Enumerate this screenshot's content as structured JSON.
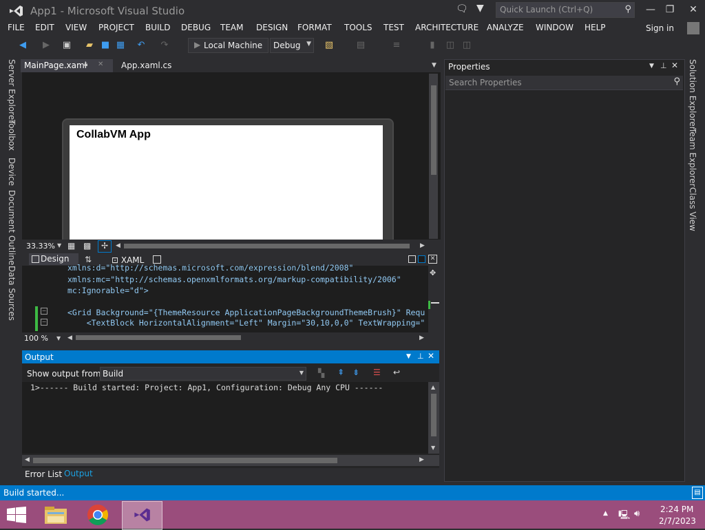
{
  "window": {
    "title": "App1 - Microsoft Visual Studio",
    "quick_launch_placeholder": "Quick Launch (Ctrl+Q)"
  },
  "menu": [
    "FILE",
    "EDIT",
    "VIEW",
    "PROJECT",
    "BUILD",
    "DEBUG",
    "TEAM",
    "DESIGN",
    "FORMAT",
    "TOOLS",
    "TEST",
    "ARCHITECTURE",
    "ANALYZE",
    "WINDOW",
    "HELP"
  ],
  "signin": "Sign in",
  "toolbar": {
    "target": "Local Machine",
    "config": "Debug"
  },
  "left_tabs": [
    "Server Explorer",
    "Toolbox",
    "Device",
    "Document Outline",
    "Data Sources"
  ],
  "right_tabs": [
    "Solution Explorer",
    "Team Explorer",
    "Class View"
  ],
  "doc_tabs": {
    "active": "MainPage.xaml",
    "other": "App.xaml.cs"
  },
  "designer": {
    "app_title": "CollabVM App",
    "zoom": "33.33%"
  },
  "view_switch": {
    "design": "Design",
    "xaml": "XAML"
  },
  "code_lines": [
    "xmlns:d=\"http://schemas.microsoft.com/expression/blend/2008\"",
    "xmlns:mc=\"http://schemas.openxmlformats.org/markup-compatibility/2006\"",
    "mc:Ignorable=\"d\">",
    "",
    "<Grid Background=\"{ThemeResource ApplicationPageBackgroundThemeBrush}\" Requ",
    "    <TextBlock HorizontalAlignment=\"Left\" Margin=\"30,10,0,0\" TextWrapping=\""
  ],
  "code_zoom": "100 %",
  "properties": {
    "title": "Properties",
    "search_placeholder": "Search Properties"
  },
  "output": {
    "title": "Output",
    "show_from_label": "Show output from:",
    "source": "Build",
    "line": "1>------ Build started: Project: App1, Configuration: Debug Any CPU ------"
  },
  "bottom_tabs": {
    "error_list": "Error List",
    "output": "Output"
  },
  "status": "Build started...",
  "clock": {
    "time": "2:24 PM",
    "date": "2/7/2023"
  },
  "colors": {
    "accent": "#007acc",
    "taskbar": "#9a4d7c",
    "bg": "#2d2d30"
  }
}
